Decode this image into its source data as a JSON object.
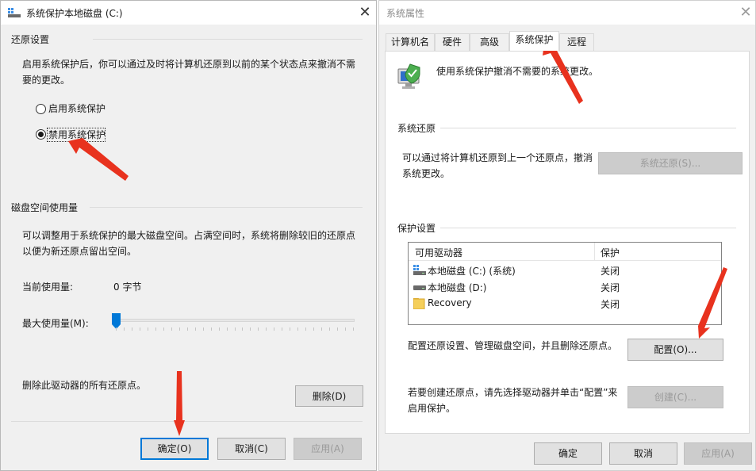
{
  "left_window": {
    "title": "系统保护本地磁盘 (C:)",
    "restore_group_label": "还原设置",
    "restore_desc": "启用系统保护后，你可以通过及时将计算机还原到以前的某个状态点来撤消不需要的更改。",
    "radio_enable": "启用系统保护",
    "radio_disable": "禁用系统保护",
    "selected_radio": "disable",
    "disk_group_label": "磁盘空间使用量",
    "disk_desc": "可以调整用于系统保护的最大磁盘空间。占满空间时，系统将删除较旧的还原点以便为新还原点留出空间。",
    "current_usage_label": "当前使用量:",
    "current_usage_value": "0 字节",
    "max_usage_label": "最大使用量(M):",
    "max_usage_fraction": 0,
    "delete_desc": "删除此驱动器的所有还原点。",
    "delete_button": "删除(D)",
    "ok_button": "确定(O)",
    "cancel_button": "取消(C)",
    "apply_button": "应用(A)"
  },
  "right_window": {
    "title": "系统属性",
    "tabs": [
      "计算机名",
      "硬件",
      "高级",
      "系统保护",
      "远程"
    ],
    "active_tab": "系统保护",
    "header_desc": "使用系统保护撤消不需要的系统更改。",
    "system_restore_label": "系统还原",
    "system_restore_desc": "可以通过将计算机还原到上一个还原点，撤消系统更改。",
    "system_restore_button": "系统还原(S)...",
    "protection_label": "保护设置",
    "list_columns": [
      "可用驱动器",
      "保护"
    ],
    "drives": [
      {
        "name": "本地磁盘 (C:) (系统)",
        "protection": "关闭",
        "icon": "system-drive-icon"
      },
      {
        "name": "本地磁盘 (D:)",
        "protection": "关闭",
        "icon": "drive-icon"
      },
      {
        "name": "Recovery",
        "protection": "关闭",
        "icon": "folder-icon"
      }
    ],
    "configure_desc": "配置还原设置、管理磁盘空间，并且删除还原点。",
    "configure_button": "配置(O)...",
    "create_desc": "若要创建还原点，请先选择驱动器并单击“配置”来启用保护。",
    "create_button": "创建(C)...",
    "ok_button": "确定",
    "cancel_button": "取消",
    "apply_button": "应用(A)"
  },
  "colors": {
    "accent": "#0078d7",
    "annotation_arrow": "#e8321e",
    "window_bg": "#f0f0f0"
  }
}
